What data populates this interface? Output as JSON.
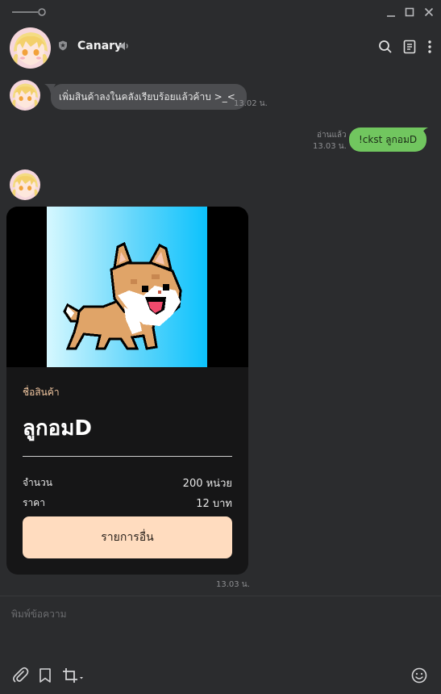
{
  "window": {
    "controls": [
      "minimize-icon",
      "maximize-icon",
      "close-icon"
    ]
  },
  "header": {
    "chat_name": "Canary",
    "icons": [
      "shield-icon",
      "speaker-icon",
      "search-icon",
      "notes-icon",
      "more-icon"
    ]
  },
  "messages": {
    "incoming_text": "เพิ่มสินค้าลงในคลังเรียบร้อยแล้วค้าบ >_<",
    "incoming_time": "13.02 น.",
    "outgoing_text": "!ckst ลูกอมD",
    "outgoing_read": "อ่านแล้ว",
    "outgoing_time": "13.03 น.",
    "card_time": "13.03 น."
  },
  "product_card": {
    "label": "ชื่อสินค้า",
    "name": "ลูกอมD",
    "rows": [
      {
        "label": "จำนวน",
        "value": "200 หน่วย"
      },
      {
        "label": "ราคา",
        "value": "12 บาท"
      }
    ],
    "button_label": "รายการอื่น",
    "image": "pixel-shiba-dog"
  },
  "composer": {
    "placeholder": "พิมพ์ข้อความ",
    "value": "",
    "tools": [
      "paperclip-icon",
      "bookmark-icon",
      "crop-icon",
      "emoji-icon"
    ]
  },
  "colors": {
    "background": "#2b2c2e",
    "outgoing_bubble": "#71c65f",
    "incoming_bubble": "#4c4d50",
    "card_background": "#161617",
    "card_button": "#ffdcbf",
    "card_label": "#f3c8a2"
  }
}
